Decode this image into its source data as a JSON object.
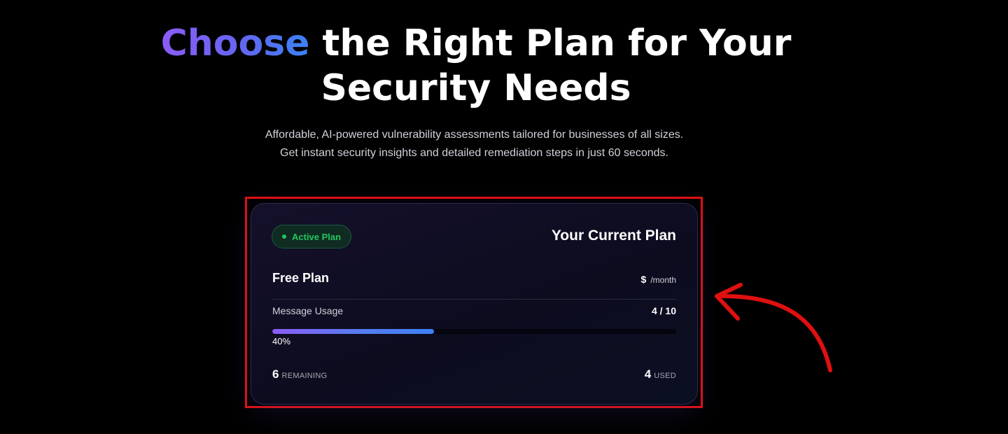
{
  "hero": {
    "title_accent": "Choose",
    "title_rest_line1": " the Right Plan for Your",
    "title_line2": "Security Needs",
    "subtitle_line1": "Affordable, AI-powered vulnerability assessments tailored for businesses of all sizes.",
    "subtitle_line2": "Get instant security insights and detailed remediation steps in just 60 seconds."
  },
  "plan_card": {
    "badge_label": "Active Plan",
    "heading": "Your Current Plan",
    "plan_name": "Free Plan",
    "price_currency": "$",
    "price_period": "/month",
    "usage_label": "Message Usage",
    "usage_count": "4 / 10",
    "usage_fraction": 0.4,
    "usage_percent_label": "40%",
    "remaining_value": "6",
    "remaining_caption": "REMAINING",
    "used_value": "4",
    "used_caption": "USED"
  },
  "colors": {
    "accent_purple": "#8b5cf6",
    "accent_blue": "#3b82f6",
    "active_green": "#22c55e",
    "highlight_red": "#e01010"
  },
  "icons": {
    "status": "status-dot-icon",
    "annotation": "curved-arrow-icon"
  }
}
